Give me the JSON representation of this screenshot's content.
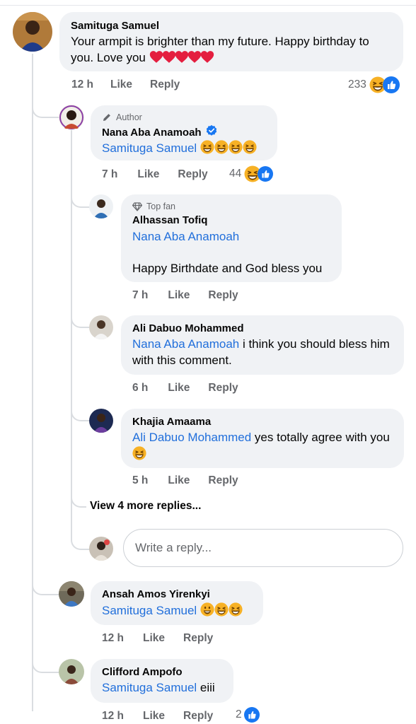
{
  "comments": {
    "samituga": {
      "name": "Samituga Samuel",
      "text": "Your armpit is brighter than my future. Happy birthday to you. Love you",
      "time": "12 h",
      "like": "Like",
      "reply": "Reply",
      "reaction_count": "233"
    },
    "nana": {
      "badge": "Author",
      "name": "Nana Aba Anamoah",
      "mention": "Samituga Samuel",
      "time": "7 h",
      "like": "Like",
      "reply": "Reply",
      "reaction_count": "44"
    },
    "alhassan": {
      "badge": "Top fan",
      "name": "Alhassan Tofiq",
      "mention": "Nana Aba Anamoah",
      "text": "Happy Birthdate and God bless you",
      "time": "7 h",
      "like": "Like",
      "reply": "Reply"
    },
    "ali": {
      "name": "Ali Dabuo Mohammed",
      "mention": "Nana Aba Anamoah",
      "text": " i think you should bless him with this comment.",
      "time": "6 h",
      "like": "Like",
      "reply": "Reply"
    },
    "khajia": {
      "name": "Khajia Amaama",
      "mention": "Ali Dabuo Mohammed",
      "text": " yes totally agree with you",
      "time": "5 h",
      "like": "Like",
      "reply": "Reply"
    },
    "view_more": "View 4 more replies...",
    "reply_placeholder": "Write a reply...",
    "ansah": {
      "name": "Ansah Amos Yirenkyi",
      "mention": "Samituga Samuel",
      "time": "12 h",
      "like": "Like",
      "reply": "Reply"
    },
    "clifford": {
      "name": "Clifford Ampofo",
      "mention": "Samituga Samuel",
      "text": " eiii",
      "time": "12 h",
      "like": "Like",
      "reply": "Reply",
      "reaction_count": "2"
    }
  },
  "icons": {
    "heart": "red-heart-emoji",
    "laugh": "grinning-squint-emoji",
    "like": "like-thumb-icon",
    "author": "pencil-icon",
    "topfan": "diamond-icon",
    "verified": "verified-badge-icon"
  },
  "colors": {
    "mention": "#216fdb",
    "bubble": "#f0f2f5",
    "meta": "#65676b",
    "heart": "#e41e3f",
    "like_blue": "#1877f2",
    "emoji_yellow": "#f7b125"
  }
}
